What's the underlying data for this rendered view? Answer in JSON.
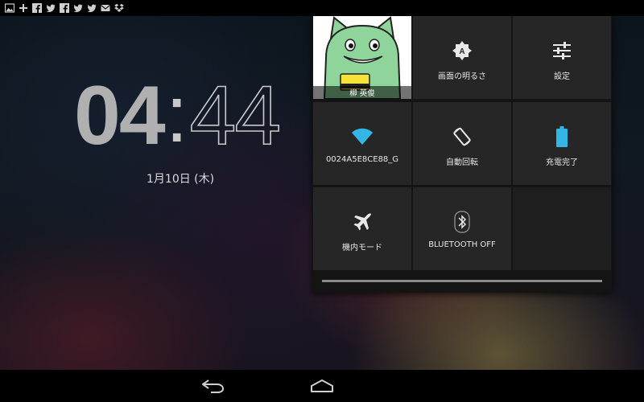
{
  "status_bar": {
    "notification_icons": [
      "gallery-icon",
      "wordpress-icon",
      "facebook-icon",
      "twitter-icon",
      "facebook-icon",
      "twitter-icon",
      "twitter-icon",
      "email-icon",
      "dropbox-icon"
    ]
  },
  "lockscreen": {
    "clock_hours": "04",
    "clock_colon": ":",
    "clock_minutes": "44",
    "date": "1月10日 (木)"
  },
  "quick_settings": {
    "user_name": "柳 英俊",
    "tiles": {
      "brightness": "画面の明るさ",
      "settings": "設定",
      "wifi": "0024A5E8CE88_G",
      "auto_rotate": "自動回転",
      "battery": "充電完了",
      "airplane": "機内モード",
      "bluetooth": "BLUETOOTH OFF"
    },
    "colors": {
      "accent": "#33b5e5",
      "tile_bg": "#262626",
      "panel_bg": "#141414"
    }
  },
  "nav_bar": {
    "buttons": [
      "back-icon",
      "home-icon"
    ]
  }
}
